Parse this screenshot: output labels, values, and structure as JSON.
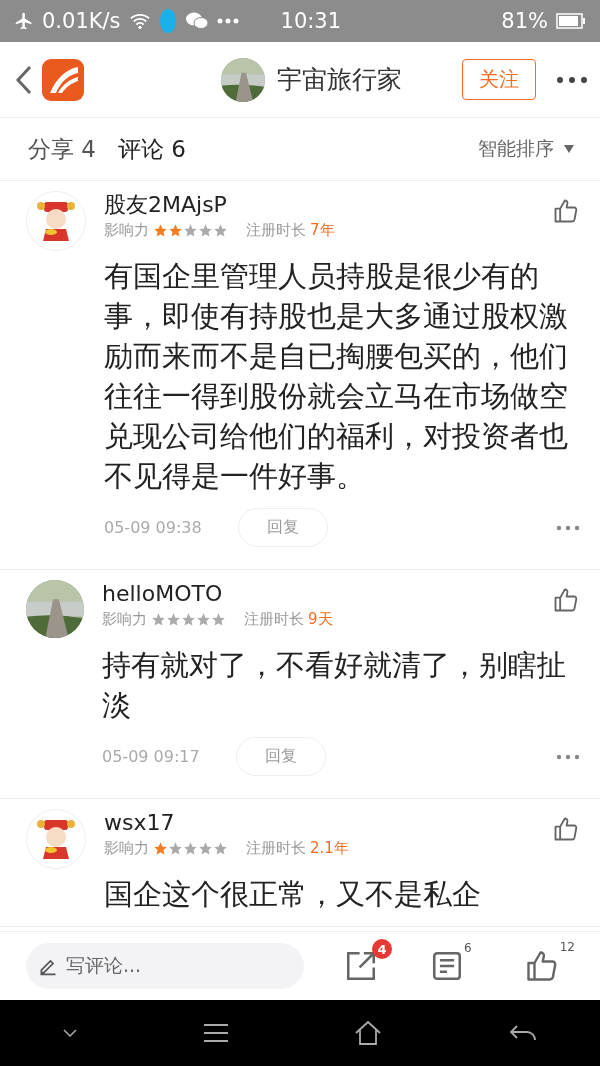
{
  "status_bar": {
    "speed": "0.01K/s",
    "time": "10:31",
    "battery": "81%"
  },
  "header": {
    "title": "宇宙旅行家",
    "follow": "关注"
  },
  "tabs": [
    {
      "label": "分享 4",
      "selected": false
    },
    {
      "label": "评论 6",
      "selected": true
    }
  ],
  "sort": "智能排序",
  "comments": [
    {
      "avatar": {
        "kind": "cartoon"
      },
      "name": "股友2MAjsP",
      "influence_label": "影响力",
      "stars": 2,
      "reg_label": "注册时长",
      "reg_value": "7年",
      "body": "有国企里管理人员持股是很少有的事，即使有持股也是大多通过股权激励而来而不是自已掏腰包买的，他们往往一得到股份就会立马在市场做空兑现公司给他们的福利，对投资者也不见得是一件好事。",
      "time": "05-09 09:38",
      "reply": "回复"
    },
    {
      "name": "helloMOTO",
      "influence_label": "影响力",
      "stars": 0,
      "reg_label": "注册时长",
      "reg_value": "9天",
      "body": "持有就对了，不看好就清了，别瞎扯淡",
      "time": "05-09 09:17",
      "reply": "回复"
    },
    {
      "avatar": {
        "kind": "cartoon"
      },
      "name": "wsx17",
      "influence_label": "影响力",
      "stars": 1,
      "reg_label": "注册时长",
      "reg_value": "2.1年",
      "body": "国企这个很正常，又不是私企"
    }
  ],
  "bottom_bar": {
    "placeholder": "写评论...",
    "share_badge": "4",
    "comment_count": "6",
    "like_count": "12"
  }
}
